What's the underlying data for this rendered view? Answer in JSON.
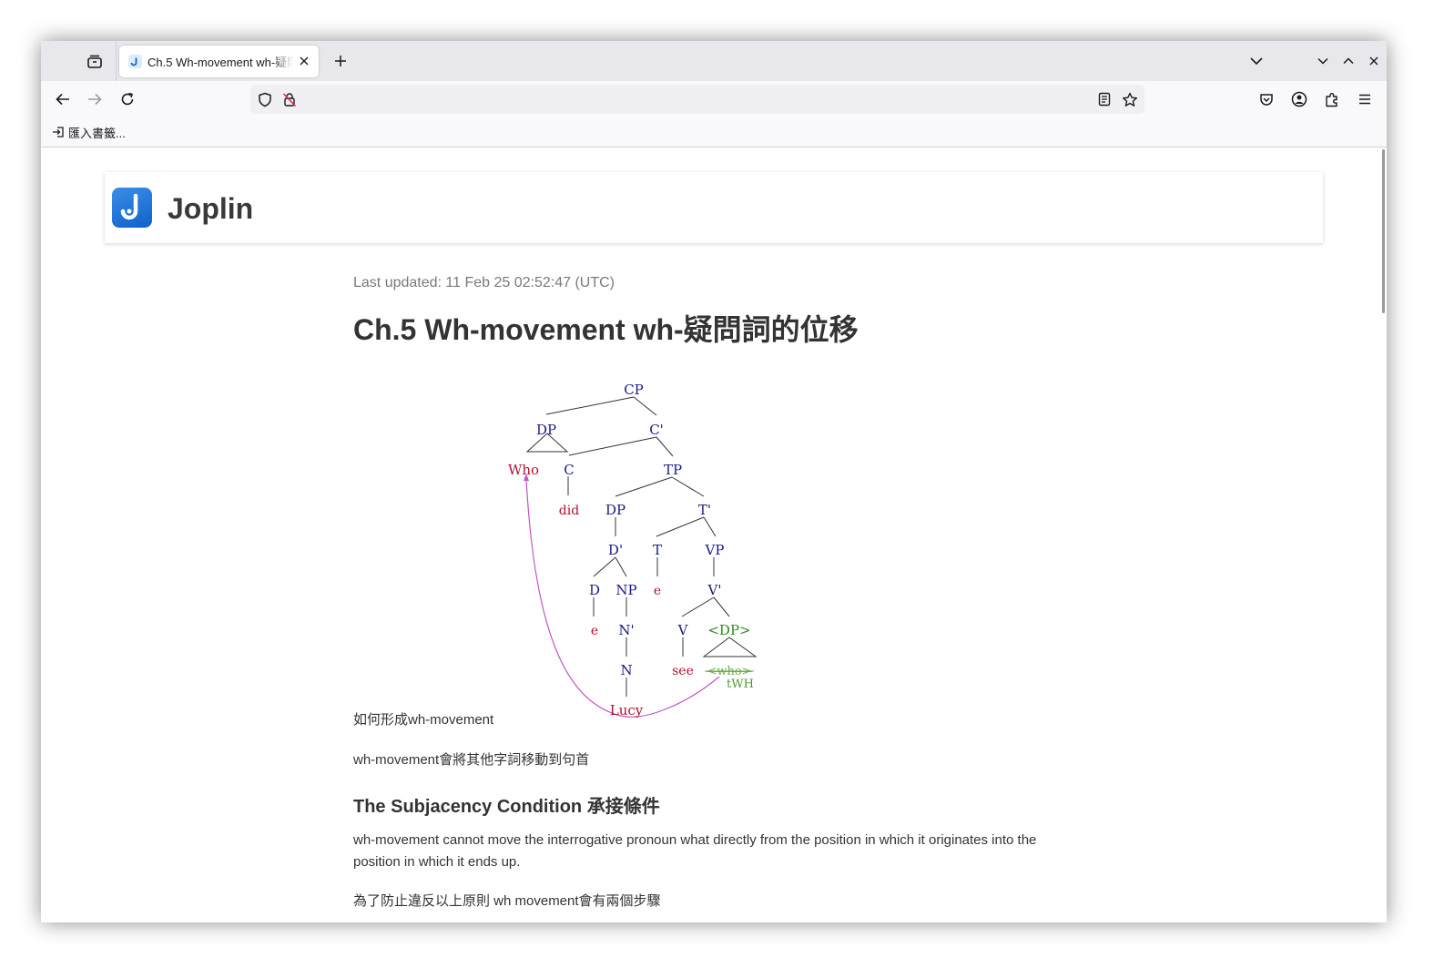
{
  "browser": {
    "tab_title": "Ch.5 Wh-movement wh-疑問詞的位移",
    "bookmark_label": "匯入書籤...",
    "url": ""
  },
  "app": {
    "name": "Joplin"
  },
  "note": {
    "last_updated": "Last updated: 11 Feb 25 02:52:47 (UTC)",
    "title": "Ch.5 Wh-movement wh-疑問詞的位移",
    "paragraph_1": "如何形成wh-movement",
    "paragraph_2": "wh-movement會將其他字詞移動到句首",
    "heading_2": "The Subjacency Condition 承接條件",
    "paragraph_3_line1": "wh-movement cannot move the interrogative pronoun what directly from the position in which it originates into the",
    "paragraph_3_line2": "position in which it ends up.",
    "paragraph_4": "為了防止違反以上原則 wh movement會有兩個步驟"
  },
  "tree": {
    "cp": "CP",
    "dp1": "DP",
    "cbar": "C'",
    "who": "Who",
    "c": "C",
    "tp": "TP",
    "did": "did",
    "dp2": "DP",
    "tbar": "T'",
    "dbar": "D'",
    "t": "T",
    "vp": "VP",
    "d": "D",
    "np": "NP",
    "e_t": "e",
    "vbar": "V'",
    "e_d": "e",
    "nbar": "N'",
    "v": "V",
    "dp3": "<DP>",
    "n": "N",
    "see": "see",
    "who_trace": "<who>",
    "twh": "tWH",
    "lucy": "Lucy"
  }
}
